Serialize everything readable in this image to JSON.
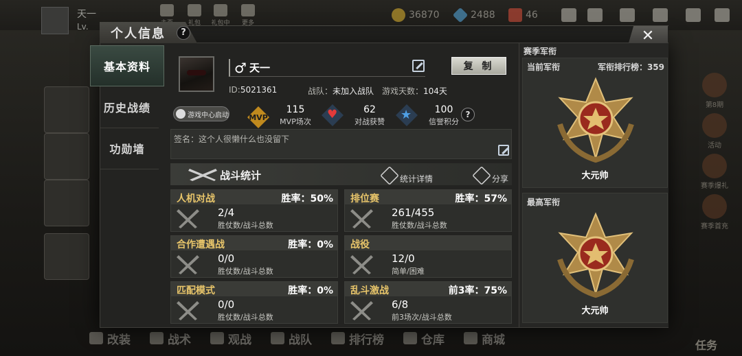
{
  "topbar": {
    "player_name": "天一",
    "level_prefix": "Lv.",
    "nav": [
      {
        "label": "主页"
      },
      {
        "label": "礼包"
      },
      {
        "label": "礼包中心"
      },
      {
        "label": "更多"
      }
    ],
    "coins": "36870",
    "gems": "2488",
    "tickets": "46"
  },
  "modal": {
    "title": "个人信息",
    "close": "✕"
  },
  "side_menu": {
    "items": [
      {
        "label": "基本资料",
        "active": true
      },
      {
        "label": "历史战绩",
        "active": false
      },
      {
        "label": "功勋墙",
        "active": false
      }
    ]
  },
  "profile": {
    "gender": "♂",
    "name": "天一",
    "copy_label": "复 制",
    "id_label": "ID:",
    "id": "5021361",
    "team_label": "战队：",
    "team": "未加入战队",
    "days_label": "游戏天数：",
    "days": "104天",
    "game_center_label": "游戏中心启动"
  },
  "stats": {
    "mvp_badge": "MVP",
    "mvp_value": "115",
    "mvp_label": "MVP场次",
    "likes_value": "62",
    "likes_label": "对战获赞",
    "credit_value": "100",
    "credit_label": "信誉积分",
    "help": "?"
  },
  "signature": {
    "text": "签名：这个人很懒什么也没留下"
  },
  "combat": {
    "title": "战斗统计",
    "details_label": "统计详情",
    "share_label": "分享",
    "cards": [
      {
        "title": "人机对战",
        "rate": "胜率：50%",
        "value": "2/4",
        "sub": "胜仗数/战斗总数"
      },
      {
        "title": "排位赛",
        "rate": "胜率：57%",
        "value": "261/455",
        "sub": "胜仗数/战斗总数"
      },
      {
        "title": "合作遭遇战",
        "rate": "胜率：0%",
        "value": "0/0",
        "sub": "胜仗数/战斗总数"
      },
      {
        "title": "战役",
        "rate": "",
        "value": "12/0",
        "sub": "简单/困难"
      },
      {
        "title": "匹配模式",
        "rate": "胜率：0%",
        "value": "0/0",
        "sub": "胜仗数/战斗总数"
      },
      {
        "title": "乱斗激战",
        "rate": "前3率：75%",
        "value": "6/8",
        "sub": "前3场次/战斗总数"
      }
    ]
  },
  "rank": {
    "title": "赛季军衔",
    "current_label": "当前军衔",
    "current_rank_board": "军衔排行榜：359",
    "current_name": "大元帅",
    "highest_label": "最高军衔",
    "highest_name": "大元帅"
  },
  "bottom_nav": [
    "改装",
    "战术",
    "观战",
    "战队",
    "排行榜",
    "仓库",
    "商城"
  ],
  "right_rail": [
    "第8期",
    "活动",
    "赛季爆礼",
    "赛季首充"
  ],
  "task_label": "任务",
  "colors": {
    "accent_gold": "#e8c56a",
    "active_tab": "#3a4a42"
  }
}
